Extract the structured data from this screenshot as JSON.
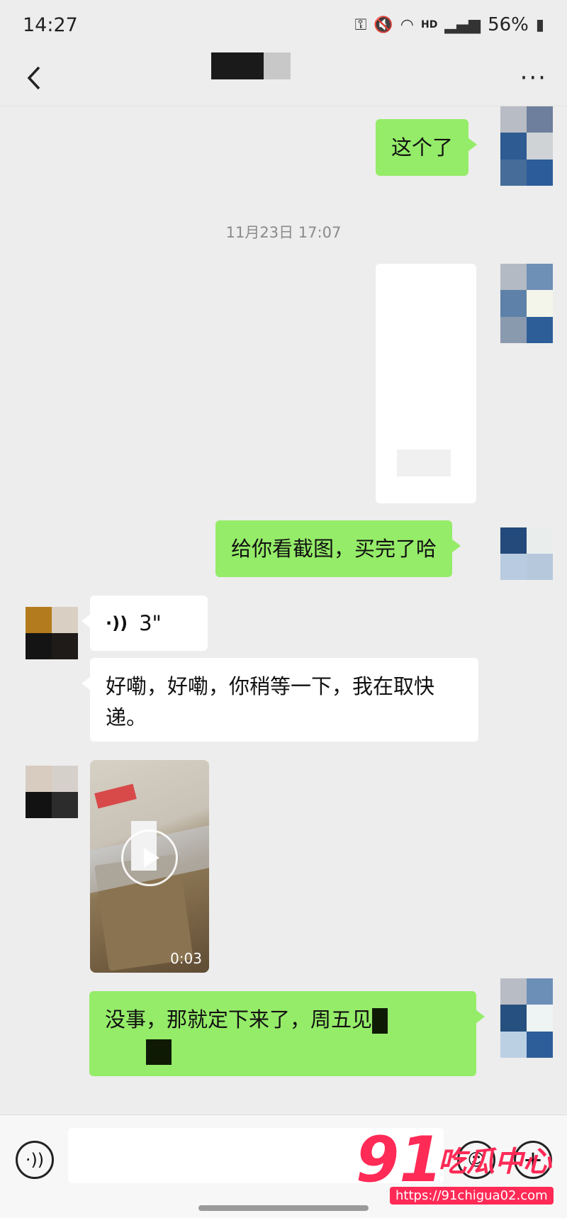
{
  "status_bar": {
    "time": "14:27",
    "network": "HD",
    "battery": "56%"
  },
  "nav": {
    "more_label": "···"
  },
  "messages": {
    "m1_text": "这个了",
    "timestamp": "11月23日 17:07",
    "m3_text": "给你看截图，买完了哈",
    "voice_duration": "3\"",
    "m5_text": "好嘞，好嘞，你稍等一下，我在取快递。",
    "video_duration": "0:03",
    "m7_text_line1": "没事，那就定下来了，周五见"
  },
  "watermark": {
    "number": "91",
    "text": "吃瓜中心",
    "url": "https://91chigua02.com"
  },
  "colors": {
    "my_bubble": "#95ec69",
    "their_bubble": "#ffffff",
    "background": "#ededed"
  }
}
